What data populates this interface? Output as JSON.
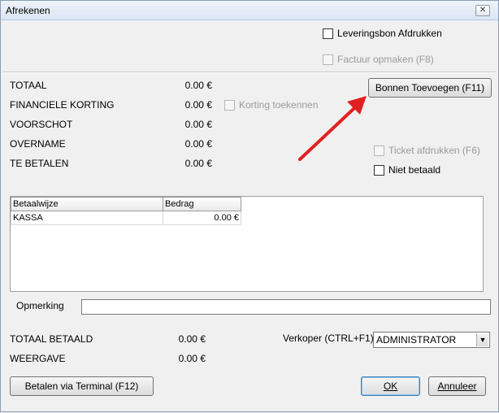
{
  "window": {
    "title": "Afrekenen",
    "close_glyph": "✕"
  },
  "checkboxes": {
    "leveringsbon": "Leveringsbon Afdrukken",
    "factuur": "Factuur opmaken (F8)",
    "korting": "Korting toekennen",
    "ticket": "Ticket afdrukken (F6)",
    "niet_betaald": "Niet betaald"
  },
  "totals": [
    {
      "label": "TOTAAL",
      "value": "0.00 €"
    },
    {
      "label": "FINANCIELE KORTING",
      "value": "0.00 €"
    },
    {
      "label": "VOORSCHOT",
      "value": "0.00 €"
    },
    {
      "label": "OVERNAME",
      "value": "0.00 €"
    },
    {
      "label": "TE BETALEN",
      "value": "0.00 €"
    }
  ],
  "buttons": {
    "bonnen": "Bonnen Toevoegen (F11)",
    "terminal": "Betalen via Terminal (F12)",
    "ok": "OK",
    "annuleer": "Annuleer"
  },
  "payments": {
    "headers": [
      "Betaalwijze",
      "Bedrag"
    ],
    "rows": [
      {
        "method": "KASSA",
        "amount": "0.00 €"
      }
    ]
  },
  "opmerking": {
    "label": "Opmerking",
    "value": ""
  },
  "summary": [
    {
      "label": "TOTAAL BETAALD",
      "value": "0.00 €"
    },
    {
      "label": "WEERGAVE",
      "value": "0.00 €"
    }
  ],
  "verkoper": {
    "label": "Verkoper (CTRL+F1)",
    "selected": "ADMINISTRATOR"
  },
  "annotation_color": "#e02020"
}
